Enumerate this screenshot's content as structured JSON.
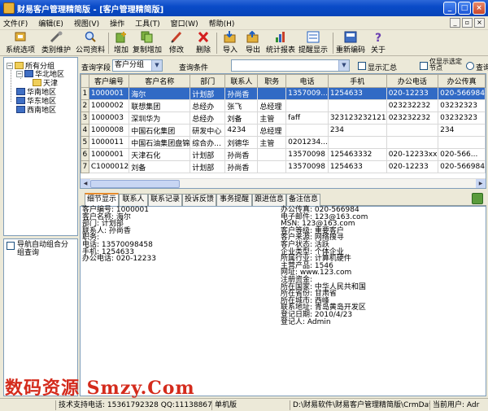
{
  "window": {
    "title": "财易客户管理精简版 - [客户管理精简版]"
  },
  "menu": [
    "文件(F)",
    "编辑(E)",
    "视图(V)",
    "操作",
    "工具(T)",
    "窗口(W)",
    "帮助(H)"
  ],
  "toolbar": [
    {
      "label": "系统选项",
      "icon": "settings-icon"
    },
    {
      "label": "类别维护",
      "icon": "tools-icon"
    },
    {
      "label": "公司资料",
      "icon": "magnifier-icon"
    },
    {
      "label": "增加",
      "icon": "add-icon"
    },
    {
      "label": "复制增加",
      "icon": "copy-add-icon"
    },
    {
      "label": "修改",
      "icon": "pencil-icon"
    },
    {
      "label": "删除",
      "icon": "delete-icon"
    },
    {
      "label": "导入",
      "icon": "import-icon"
    },
    {
      "label": "导出",
      "icon": "export-icon"
    },
    {
      "label": "统计报表",
      "icon": "chart-icon"
    },
    {
      "label": "提醒显示",
      "icon": "reminder-icon"
    },
    {
      "label": "重新编码",
      "icon": "recode-icon"
    },
    {
      "label": "关于",
      "icon": "help-icon"
    }
  ],
  "search": {
    "field_label": "查询字段",
    "field_value": "客户分组",
    "cond_label": "查询条件",
    "cond_value": "",
    "show_summary": "显示汇总",
    "show_only_subnodes": "仅显示选定节点",
    "query": "查询"
  },
  "tree": {
    "root": "所有分组",
    "nodes": [
      "华北地区",
      "天津",
      "华南地区",
      "华东地区",
      "西南地区"
    ]
  },
  "nav_option": "导航自动组合分组查询",
  "grid": {
    "columns": [
      "",
      "客户编号",
      "客户名称",
      "部门",
      "联系人",
      "职务",
      "电话",
      "手机",
      "办公电话",
      "办公传真"
    ],
    "rows": [
      [
        "1",
        "1000001",
        "海尔",
        "计划部",
        "孙尚香",
        "",
        "1357009...",
        "1254633",
        "020-12233",
        "020-566984"
      ],
      [
        "2",
        "1000002",
        "联想集团",
        "总经办",
        "张飞",
        "总经理",
        "",
        "",
        "023232232",
        "03232323"
      ],
      [
        "3",
        "1000003",
        "深圳华为",
        "总经办",
        "刘备",
        "主管",
        "faff",
        "323123232121",
        "023232232",
        "03232323"
      ],
      [
        "4",
        "1000008",
        "中国石化集团",
        "研发中心",
        "4234",
        "总经理",
        "",
        "234",
        "",
        "234"
      ],
      [
        "5",
        "1000011",
        "中国石油集团盘锦",
        "综合办...",
        "刘德华",
        "主管",
        "0201234...",
        "",
        "",
        ""
      ],
      [
        "6",
        "1000001",
        "天津石化",
        "计划部",
        "孙尚香",
        "",
        "13570098",
        "125463332",
        "020-12233xx",
        "020-566..."
      ],
      [
        "7",
        "C1000012",
        "刘备",
        "计划部",
        "孙尚香",
        "",
        "13570098",
        "1254633",
        "020-12233",
        "020-566984"
      ]
    ]
  },
  "tabs": [
    "细节显示",
    "联系人",
    "联系记录",
    "投诉反馈",
    "事务提醒",
    "跟进信息",
    "备注信息"
  ],
  "detail": {
    "left": [
      "客户编号: 1000001",
      "客户名称: 海尔",
      "部门: 计划部",
      "联系人: 孙尚香",
      "职务:",
      "电话: 13570098458",
      "手机: 1254633",
      "办公电话: 020-12233"
    ],
    "right": [
      "办公传真: 020-566984",
      "电子邮件: 123@163.com",
      "MSN: 123@163.com",
      "客户等级: 重要客户",
      "客户来源: 网络搜寻",
      "客户状态: 活跃",
      "企业类型: 个体企业",
      "所属行业: 计算机硬件",
      "主营产品: 1546",
      "网址: www.123.com",
      "注册资金:",
      "所在国家: 中华人民共和国",
      "所在省份: 甘肃省",
      "所在城市: 西峰",
      "联系地址: 青岛黄岛开发区",
      "登记日期: 2010/4/23",
      "登记人: Admin"
    ]
  },
  "watermark": "数码资源 Smzy.Com",
  "status": {
    "support": "技术支持电话: 15361792328 QQ:1113886749",
    "edition": "单机版",
    "path": "D:\\财易软件\\财易客户管理精简版\\CrmData.sys",
    "user": "当前用户: Adr"
  },
  "colors": {
    "selection": "#316ac5",
    "titlebar": "#0a4bc8",
    "watermark": "#d42b1c"
  }
}
